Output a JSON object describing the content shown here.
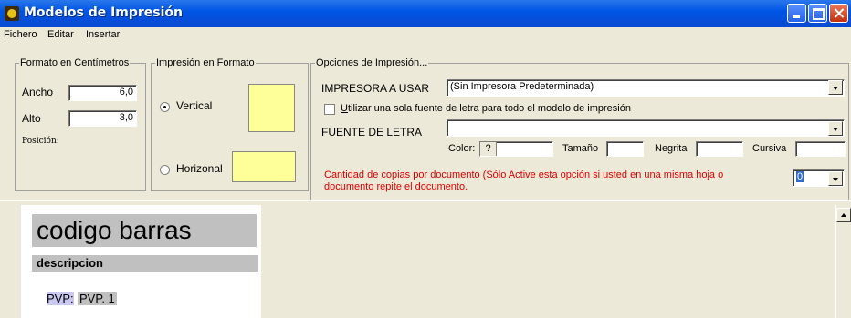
{
  "window": {
    "title": "Modelos de Impresión"
  },
  "menu": [
    "Fichero",
    "Editar",
    "Insertar"
  ],
  "formato_cm": {
    "legend": "Formato en Centímetros",
    "ancho_label": "Ancho",
    "ancho_value": "6,0",
    "alto_label": "Alto",
    "alto_value": "3,0",
    "posicion_label": "Posición:"
  },
  "formato_impresion": {
    "legend": "Impresión en Formato",
    "vertical_label": "Vertical",
    "horizontal_label": "Horizonal",
    "selected": "Vertical"
  },
  "opciones": {
    "legend": "Opciones de Impresión...",
    "impresora_label": "IMPRESORA A USAR",
    "impresora_value": "(Sin Impresora Predeterminada)",
    "una_fuente_label": "Utilizar una sola fuente de letra para todo el modelo de impresión",
    "una_fuente_checked": false,
    "fuente_label": "FUENTE DE LETRA",
    "fuente_value": "",
    "color_label": "Color:",
    "color_button": "?",
    "tamano_label": "Tamaño",
    "negrita_label": "Negrita",
    "cursiva_label": "Cursiva",
    "copias_text": "Cantidad de copias por documento (Sólo Active esta opción si usted en una misma hoja o documento repite el documento.",
    "copias_value": "0"
  },
  "preview": {
    "codigo": "codigo barras",
    "descripcion": "descripcion",
    "pvp_label": "PVP:",
    "pvp_value": "PVP. 1"
  },
  "colors": {
    "title_blue": "#0055E5",
    "yellow_swatch": "#ffff99",
    "warning_red": "#e00000",
    "pvp_highlight": "#c8c8f0"
  }
}
